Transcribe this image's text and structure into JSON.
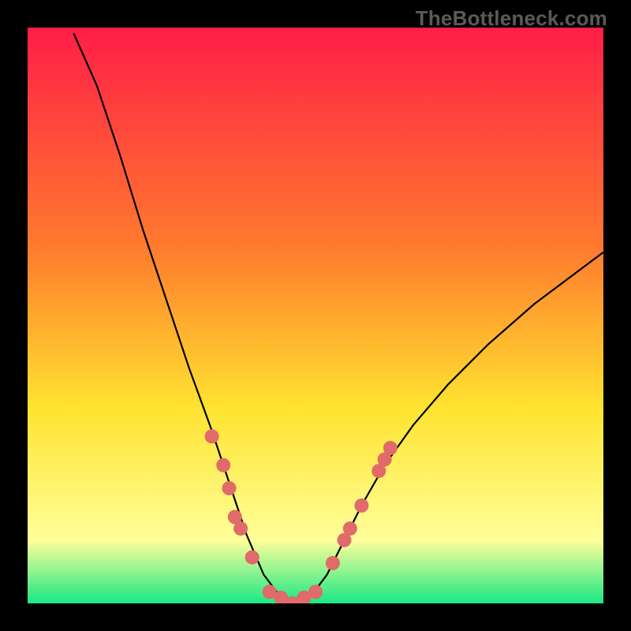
{
  "watermark": "TheBottleneck.com",
  "colors": {
    "gradient_top": "#ff1e47",
    "gradient_mid_high": "#ff7a2e",
    "gradient_mid": "#ffe32f",
    "gradient_low": "#ffff9a",
    "gradient_bottom": "#19e884",
    "curve": "#000000",
    "dots": "#e16a6a",
    "background": "#000000"
  },
  "chart_data": {
    "type": "line",
    "title": "",
    "xlabel": "",
    "ylabel": "",
    "xlim": [
      0,
      100
    ],
    "ylim": [
      0,
      100
    ],
    "grid": false,
    "legend": false,
    "curve": {
      "description": "V-shaped bottleneck curve; minimum (0%) near x≈45, rising steeply on both sides",
      "points": [
        {
          "x": 8,
          "y": 99
        },
        {
          "x": 12,
          "y": 90
        },
        {
          "x": 16,
          "y": 78
        },
        {
          "x": 20,
          "y": 65
        },
        {
          "x": 24,
          "y": 53
        },
        {
          "x": 28,
          "y": 41
        },
        {
          "x": 32,
          "y": 30
        },
        {
          "x": 35,
          "y": 21
        },
        {
          "x": 38,
          "y": 12
        },
        {
          "x": 41,
          "y": 5
        },
        {
          "x": 44,
          "y": 1
        },
        {
          "x": 46,
          "y": 0
        },
        {
          "x": 49,
          "y": 1
        },
        {
          "x": 52,
          "y": 5
        },
        {
          "x": 55,
          "y": 11
        },
        {
          "x": 58,
          "y": 17
        },
        {
          "x": 62,
          "y": 24
        },
        {
          "x": 67,
          "y": 31
        },
        {
          "x": 73,
          "y": 38
        },
        {
          "x": 80,
          "y": 45
        },
        {
          "x": 88,
          "y": 52
        },
        {
          "x": 96,
          "y": 58
        },
        {
          "x": 100,
          "y": 61
        }
      ]
    },
    "dots": {
      "description": "Highlighted data points along the curve (coral dots)",
      "points": [
        {
          "x": 32,
          "y": 29
        },
        {
          "x": 34,
          "y": 24
        },
        {
          "x": 35,
          "y": 20
        },
        {
          "x": 36,
          "y": 15
        },
        {
          "x": 37,
          "y": 13
        },
        {
          "x": 39,
          "y": 8
        },
        {
          "x": 42,
          "y": 2
        },
        {
          "x": 44,
          "y": 1
        },
        {
          "x": 46,
          "y": 0
        },
        {
          "x": 48,
          "y": 1
        },
        {
          "x": 50,
          "y": 2
        },
        {
          "x": 53,
          "y": 7
        },
        {
          "x": 55,
          "y": 11
        },
        {
          "x": 56,
          "y": 13
        },
        {
          "x": 58,
          "y": 17
        },
        {
          "x": 61,
          "y": 23
        },
        {
          "x": 62,
          "y": 25
        },
        {
          "x": 63,
          "y": 27
        }
      ]
    }
  }
}
